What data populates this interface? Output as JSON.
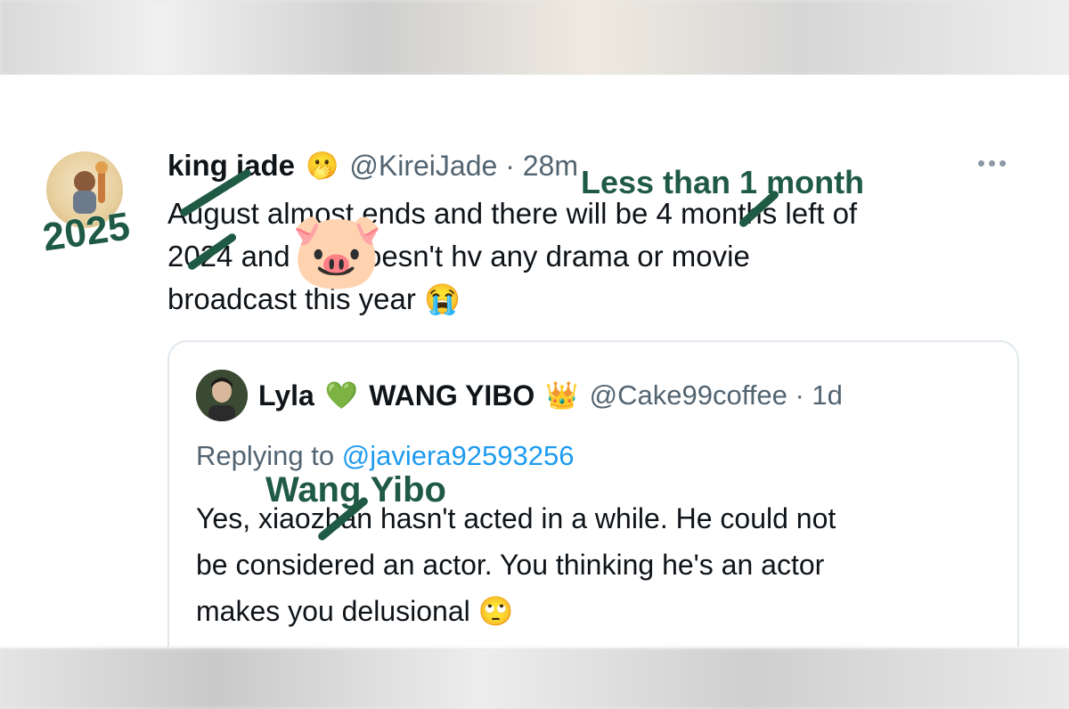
{
  "tweet": {
    "display_name": "king jade",
    "name_emoji": "🫢",
    "handle_time": "@KireiJade · 28m",
    "text_lines": [
      "August almost ends and there will be 4 months left of",
      "2024 and         still doesn't hv any drama or movie",
      "broadcast this year"
    ],
    "end_emoji": "😭"
  },
  "quote": {
    "display_name": "Lyla",
    "heart_emoji": "💚",
    "name_suffix": "WANG YIBO",
    "crown_emoji": "👑",
    "handle_time": "@Cake99coffee · 1d",
    "replying_prefix": "Replying to",
    "replying_mention": "@javiera92593256",
    "text_lines": [
      "Yes, xiaozhan hasn't acted in a while. He could not",
      "be considered an actor. You thinking he's an actor",
      "makes you delusional"
    ],
    "end_emoji": "🙄"
  },
  "annotations": {
    "year_correction": "2025",
    "months_correction": "Less than 1 month",
    "name_correction": "Wang Yibo",
    "sticker": "🐷",
    "color": "#1f5a44"
  }
}
